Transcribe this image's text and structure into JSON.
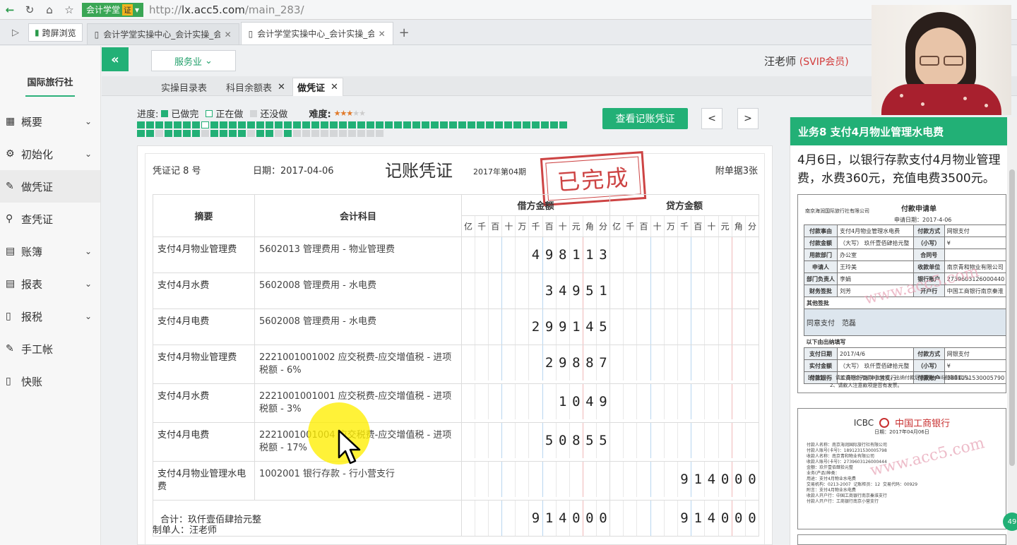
{
  "browser": {
    "site_badge": "会计学堂",
    "site_cert": "证",
    "url_prefix": "http://",
    "url_host": "lx.acc5.com",
    "url_path": "/main_283/",
    "fav_label": "跨屏浏览",
    "tabs": [
      {
        "title": "会计学堂实操中心_会计实操_会",
        "active": false
      },
      {
        "title": "会计学堂实操中心_会计实操_会",
        "active": true
      }
    ]
  },
  "sidebar": {
    "company": "国际旅行社",
    "items": [
      {
        "label": "概要",
        "icon": "dashboard-icon",
        "glyph": "▦",
        "has_chevron": true
      },
      {
        "label": "初始化",
        "icon": "gear-icon",
        "glyph": "⚙",
        "has_chevron": true
      },
      {
        "label": "做凭证",
        "icon": "pen-icon",
        "glyph": "✎",
        "has_chevron": false,
        "active": true
      },
      {
        "label": "查凭证",
        "icon": "search-icon",
        "glyph": "⚲",
        "has_chevron": false
      },
      {
        "label": "账簿",
        "icon": "ledger-icon",
        "glyph": "▤",
        "has_chevron": true
      },
      {
        "label": "报表",
        "icon": "report-icon",
        "glyph": "▤",
        "has_chevron": true
      },
      {
        "label": "报税",
        "icon": "document-icon",
        "glyph": "▯",
        "has_chevron": true
      },
      {
        "label": "手工帐",
        "icon": "pen-icon",
        "glyph": "✎",
        "has_chevron": false
      },
      {
        "label": "快账",
        "icon": "document-icon",
        "glyph": "▯",
        "has_chevron": false
      }
    ]
  },
  "header": {
    "collapse_glyph": "«",
    "industry": "服务业",
    "user_name": "汪老师",
    "user_level": "(SVIP会员)"
  },
  "app_tabs": [
    {
      "label": "实操目录表",
      "closable": false
    },
    {
      "label": "科目余额表",
      "closable": true
    },
    {
      "label": "做凭证",
      "closable": true,
      "active": true
    }
  ],
  "progress": {
    "label": "进度:",
    "done_label": "已做完",
    "doing_label": "正在做",
    "todo_label": "还没做",
    "difficulty_label": "难度:",
    "difficulty_stars": 3,
    "difficulty_max": 5,
    "cells": "dddddddddddddddddddddddddddddddddddddddddddddddddddddddddddddddddddddddddddddddddddddddddddddddddddddddddddddddddddddddddddddddddddddddddddddddddddddddd"
  },
  "actions": {
    "view_voucher": "查看记账凭证",
    "prev": "<",
    "next": ">"
  },
  "voucher": {
    "number_label": "凭证记 8 号",
    "date_label": "日期：2017-04-06",
    "title": "记账凭证",
    "period": "2017年第04期",
    "attachments": "附单据3张",
    "stamp": "已完成",
    "col_summary": "摘要",
    "col_account": "会计科目",
    "col_debit": "借方金额",
    "col_credit": "贷方金额",
    "digit_headers": [
      "亿",
      "千",
      "百",
      "十",
      "万",
      "千",
      "百",
      "十",
      "元",
      "角",
      "分"
    ],
    "rows": [
      {
        "summary": "支付4月物业管理费",
        "account": "5602013 管理费用 - 物业管理费",
        "debit": "498113",
        "credit": ""
      },
      {
        "summary": "支付4月水费",
        "account": "5602008 管理费用 - 水电费",
        "debit": "34951",
        "credit": ""
      },
      {
        "summary": "支付4月电费",
        "account": "5602008 管理费用 - 水电费",
        "debit": "299145",
        "credit": ""
      },
      {
        "summary": "支付4月物业管理费",
        "account": "2221001001002 应交税费-应交增值税 - 进项税额 - 6%",
        "debit": "29887",
        "credit": ""
      },
      {
        "summary": "支付4月水费",
        "account": "2221001001001 应交税费-应交增值税 - 进项税额 - 3%",
        "debit": "1049",
        "credit": ""
      },
      {
        "summary": "支付4月电费",
        "account": "2221001001004 应交税费-应交增值税 - 进项税额 - 17%",
        "debit": "50855",
        "credit": ""
      },
      {
        "summary": "支付4月物业管理水电费",
        "account": "1002001 银行存款 - 行小营支行",
        "debit": "",
        "credit": "914000"
      }
    ],
    "total_label": "合计：玖仟壹佰肆拾元整",
    "total_debit": "914000",
    "total_credit": "914000",
    "maker": "制单人：汪老师"
  },
  "task": {
    "title": "业务8 支付4月物业管理水电费",
    "description": "4月6日，以银行存款支付4月物业管理费，水费360元，充值电费3500元。",
    "payment_form": {
      "company": "南京海润国际旅行社有限公司",
      "title": "付款申请单",
      "date": "申请日期：2017-4-06",
      "rows": [
        [
          "付款事由",
          "支付4月物业管理水电费",
          "付款方式",
          "网银支付"
        ],
        [
          "付款金额",
          "（大写） 玖仟壹佰肆拾元整",
          "（小写）",
          "¥"
        ],
        [
          "用款部门",
          "办公室",
          "合同号",
          ""
        ],
        [
          "申请人",
          "王玲美",
          "收款单位",
          "南京青和物业有限公司"
        ],
        [
          "部门负责人",
          "李娟",
          "银行账户",
          "2739603126000440"
        ],
        [
          "财务签批",
          "刘芳",
          "开户行",
          "中国工商银行南京秦淮"
        ]
      ],
      "other_sign": "其他签批",
      "sign_text": "同意支付　范磊",
      "cashier_section": "以下由出纳填写",
      "cashier_rows": [
        [
          "支付日期",
          "2017/4/6",
          "付款方式",
          "网银支付"
        ],
        [
          "实付金额",
          "（大写） 玖仟壹佰肆拾元整",
          "（小写）",
          "¥"
        ],
        [
          "付款银行",
          "工商银行南京小营支行",
          "付款账户",
          "1891231530005790"
        ]
      ],
      "note": "【备注】　1、请款须符合内部审批流程，出纳付款后需要email通知请款人。\n　　　　　2、请款人注意款项是否有发票。"
    },
    "bank_receipt": {
      "bank_code": "ICBC",
      "bank_name": "中国工商银行",
      "date": "日期：2017年04月06日",
      "lines": "付款人名称：南京海润国际旅行社有限公司\n付款人账号(卡号)：1891231530005798\n收款人名称：南京青和物业有限公司\n收款人账号(卡号)：2739603126000444\n金额：玖仟壹佰肆拾元整\n业务(产品)种类：\n用途：支付4月物业水电费\n交易机构：0213-2007  记账柜员：12  交易代码：00929\n附言：支付4月物业水电费\n收款人开户行：中国工商银行南京秦淮支行\n付款人开户行：工商银行南京小营支行"
    },
    "watermark": "www.acc5.com",
    "counter": "49"
  }
}
